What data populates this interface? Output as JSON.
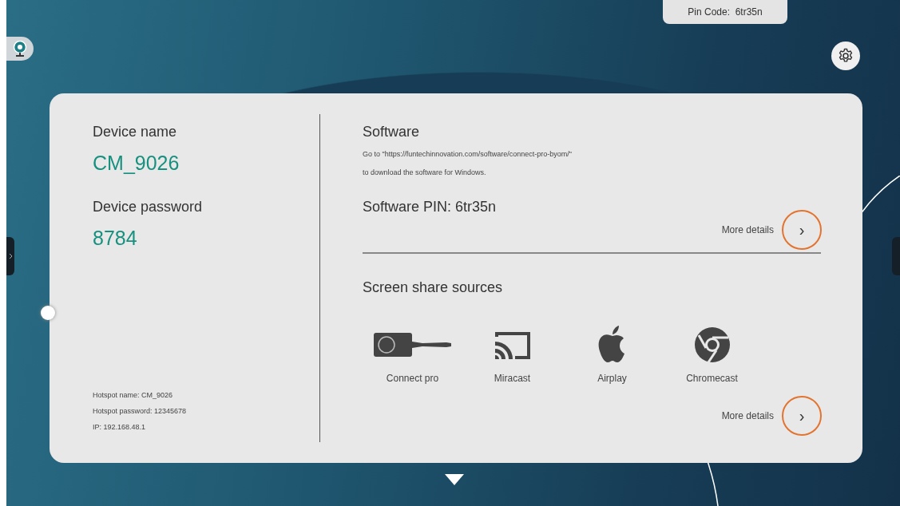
{
  "pin_code": "Pin Code:  6tr35n",
  "device": {
    "name_label": "Device name",
    "name_value": "CM_9026",
    "password_label": "Device password",
    "password_value": "8784",
    "hotspot": [
      "Hotspot name: CM_9026",
      "Hotspot password: 12345678",
      "IP: 192.168.48.1"
    ]
  },
  "software": {
    "title": "Software",
    "lines": [
      "Go to \"https://funtechinnovation.com/software/connect-pro-byom/\"",
      "to download the software for Windows."
    ],
    "pin": "Software PIN: 6tr35n",
    "more_details": "More details",
    "arrow": "›"
  },
  "screen_share": {
    "title": "Screen share sources",
    "sources": [
      {
        "label": "Connect pro",
        "kind": "dongle"
      },
      {
        "label": "Miracast",
        "kind": "cast"
      },
      {
        "label": "Airplay",
        "kind": "apple"
      },
      {
        "label": "Chromecast",
        "kind": "chrome"
      }
    ],
    "more_details": "More details",
    "arrow": "›"
  }
}
